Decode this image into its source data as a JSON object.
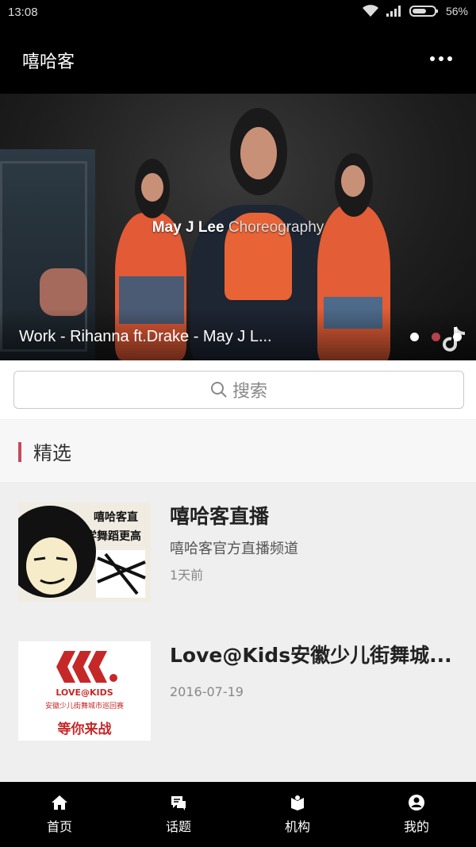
{
  "status_bar": {
    "time": "13:08",
    "battery": "56%"
  },
  "app_bar": {
    "title": "嘻哈客",
    "menu_icon": "more-dots-icon"
  },
  "banner": {
    "overlay_name": "May J Lee",
    "overlay_word": "Choreography",
    "caption": "Work - Rihanna ft.Drake - May J L...",
    "active_dot": 1,
    "dot_count": 3
  },
  "search": {
    "label": "搜索",
    "icon": "search-icon"
  },
  "section": {
    "title": "精选",
    "accent": "#c9485b"
  },
  "list": [
    {
      "title": "嘻哈客直播",
      "subtitle": "嘻哈客官方直播频道",
      "time": "1天前",
      "thumb_text_1": "嘻哈客直",
      "thumb_text_2": "学舞蹈更高"
    },
    {
      "title": "Love@Kids安徽少儿街舞城...",
      "subtitle": "",
      "time": "2016-07-19",
      "thumb_brand": "LOVE@KIDS",
      "thumb_line": "安徽少儿街舞城市巡回赛",
      "thumb_slogan": "等你来战"
    }
  ],
  "bottom_nav": [
    {
      "label": "首页",
      "icon": "home-icon"
    },
    {
      "label": "话题",
      "icon": "chat-icon"
    },
    {
      "label": "机构",
      "icon": "institution-icon"
    },
    {
      "label": "我的",
      "icon": "profile-icon"
    }
  ]
}
